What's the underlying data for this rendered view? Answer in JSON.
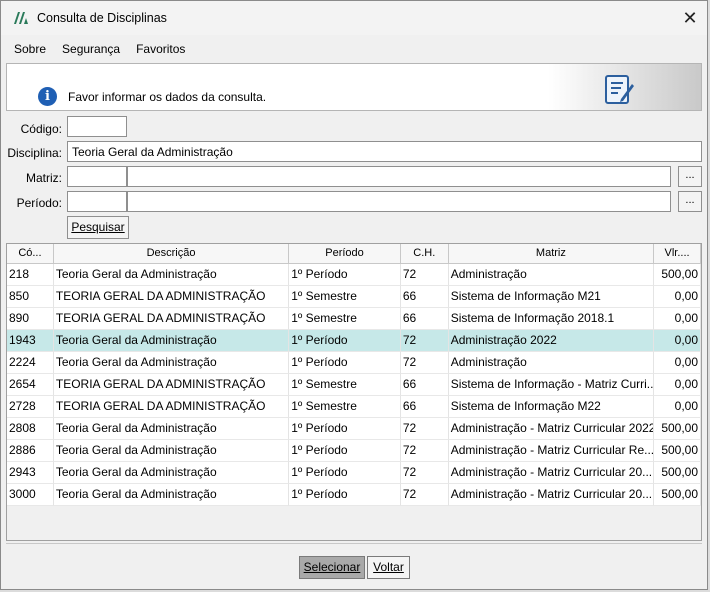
{
  "window": {
    "title": "Consulta de Disciplinas",
    "close_glyph": "✕"
  },
  "menu": {
    "items": [
      {
        "label": "Sobre"
      },
      {
        "label": "Segurança"
      },
      {
        "label": "Favoritos"
      }
    ]
  },
  "info": {
    "text": "Favor informar os dados da consulta.",
    "icon": "info-icon",
    "doc_icon": "document-edit-icon"
  },
  "form": {
    "codigo_label": "Código:",
    "codigo_value": "",
    "disciplina_label": "Disciplina:",
    "disciplina_value": "Teoria Geral da Administração",
    "matriz_label": "Matriz:",
    "matriz_code": "",
    "matriz_desc": "",
    "periodo_label": "Período:",
    "periodo_code": "",
    "periodo_desc": "",
    "lookup_label": "...",
    "search_label": "Pesquisar"
  },
  "table": {
    "columns": [
      "Có...",
      "Descrição",
      "Período",
      "C.H.",
      "Matriz",
      "Vlr...."
    ],
    "selected_index": 3,
    "rows": [
      [
        "218",
        "Teoria Geral da Administração",
        "1º Período",
        "72",
        "Administração",
        "500,00"
      ],
      [
        "850",
        "TEORIA GERAL DA ADMINISTRAÇÃO",
        "1º Semestre",
        "66",
        "Sistema de Informação M21",
        "0,00"
      ],
      [
        "890",
        "TEORIA GERAL DA ADMINISTRAÇÃO",
        "1º Semestre",
        "66",
        "Sistema de Informação 2018.1",
        "0,00"
      ],
      [
        "1943",
        "Teoria Geral da Administração",
        "1º Período",
        "72",
        "Administração 2022",
        "0,00"
      ],
      [
        "2224",
        "Teoria Geral da Administração",
        "1º Período",
        "72",
        "Administração",
        "0,00"
      ],
      [
        "2654",
        "TEORIA GERAL DA ADMINISTRAÇÃO",
        "1º Semestre",
        "66",
        "Sistema de Informação - Matriz Curri...",
        "0,00"
      ],
      [
        "2728",
        "TEORIA GERAL DA ADMINISTRAÇÃO",
        "1º Semestre",
        "66",
        "Sistema de Informação M22",
        "0,00"
      ],
      [
        "2808",
        "Teoria Geral da Administração",
        "1º Período",
        "72",
        "Administração - Matriz Curricular 2022",
        "500,00"
      ],
      [
        "2886",
        "Teoria Geral da Administração",
        "1º Período",
        "72",
        "Administração - Matriz Curricular Re...",
        "500,00"
      ],
      [
        "2943",
        "Teoria Geral da Administração",
        "1º Período",
        "72",
        "Administração - Matriz Curricular 20...",
        "500,00"
      ],
      [
        "3000",
        "Teoria Geral da Administração",
        "1º Período",
        "72",
        "Administração - Matriz Curricular 20...",
        "500,00"
      ]
    ]
  },
  "footer": {
    "select_label": "Selecionar",
    "back_label": "Voltar"
  },
  "colors": {
    "selected_row": "#c6e8e8",
    "info_icon": "#1f5fb4",
    "select_button": "#a9a9a9"
  }
}
